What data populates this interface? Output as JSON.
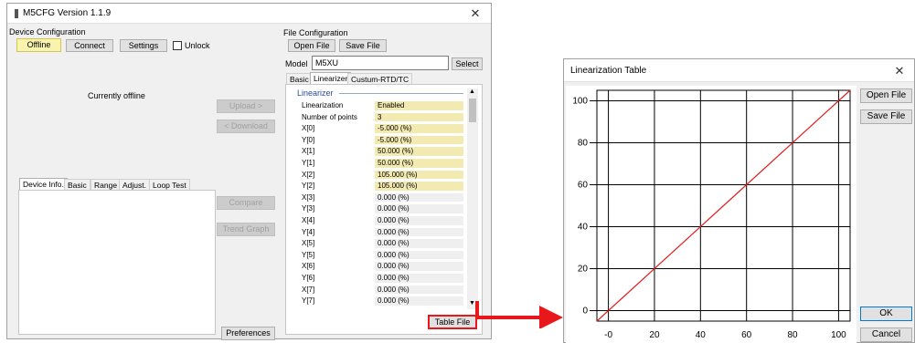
{
  "main_window": {
    "title": "M5CFG Version 1.1.9",
    "device_configuration": {
      "label": "Device Configuration",
      "offline_label": "Offline",
      "connect_label": "Connect",
      "settings_label": "Settings",
      "unlock_label": "Unlock",
      "unlock_checked": false,
      "status_text": "Currently offline",
      "tabs": [
        "Device Info.",
        "Basic",
        "Range",
        "Adjust.",
        "Loop Test"
      ]
    },
    "middle_buttons": {
      "upload_label": "Upload >",
      "download_label": "< Download",
      "compare_label": "Compare",
      "trend_graph_label": "Trend Graph",
      "preferences_label": "Preferences"
    },
    "file_configuration": {
      "label": "File Configuration",
      "open_file_label": "Open File",
      "save_file_label": "Save File",
      "model_label": "Model",
      "model_value": "M5XU",
      "select_label": "Select",
      "tabs": [
        "Basic",
        "Linearizer",
        "Custum-RTD/TC"
      ],
      "selected_tab": "Linearizer",
      "section_label": "Linearizer",
      "rows": [
        {
          "label": "Linearization",
          "value": "Enabled",
          "highlight": true
        },
        {
          "label": "Number of points",
          "value": "3",
          "highlight": true
        },
        {
          "label": "X[0]",
          "value": "-5.000 (%)",
          "highlight": true
        },
        {
          "label": "Y[0]",
          "value": "-5.000 (%)",
          "highlight": true
        },
        {
          "label": "X[1]",
          "value": "50.000 (%)",
          "highlight": true
        },
        {
          "label": "Y[1]",
          "value": "50.000 (%)",
          "highlight": true
        },
        {
          "label": "X[2]",
          "value": "105.000 (%)",
          "highlight": true
        },
        {
          "label": "Y[2]",
          "value": "105.000 (%)",
          "highlight": true
        },
        {
          "label": "X[3]",
          "value": "0.000 (%)",
          "highlight": false
        },
        {
          "label": "Y[3]",
          "value": "0.000 (%)",
          "highlight": false
        },
        {
          "label": "X[4]",
          "value": "0.000 (%)",
          "highlight": false
        },
        {
          "label": "Y[4]",
          "value": "0.000 (%)",
          "highlight": false
        },
        {
          "label": "X[5]",
          "value": "0.000 (%)",
          "highlight": false
        },
        {
          "label": "Y[5]",
          "value": "0.000 (%)",
          "highlight": false
        },
        {
          "label": "X[6]",
          "value": "0.000 (%)",
          "highlight": false
        },
        {
          "label": "Y[6]",
          "value": "0.000 (%)",
          "highlight": false
        },
        {
          "label": "X[7]",
          "value": "0.000 (%)",
          "highlight": false
        },
        {
          "label": "Y[7]",
          "value": "0.000 (%)",
          "highlight": false
        }
      ],
      "table_file_label": "Table File"
    }
  },
  "dialog": {
    "title": "Linearization Table",
    "open_file_label": "Open File",
    "save_file_label": "Save File",
    "ok_label": "OK",
    "cancel_label": "Cancel"
  },
  "colors": {
    "highlight_fill": "#f2eab0",
    "line_color": "#e02020",
    "arrow_color": "#e8171b"
  },
  "chart_data": {
    "type": "line",
    "x_ticks": [
      "-0",
      "20",
      "40",
      "60",
      "80",
      "100"
    ],
    "y_ticks": [
      "0",
      "20",
      "40",
      "60",
      "80",
      "100"
    ],
    "xlim": [
      -5,
      105
    ],
    "ylim": [
      -5,
      105
    ],
    "grid": true,
    "series": [
      {
        "x": [
          -5,
          50,
          105
        ],
        "values": [
          -5,
          50,
          105
        ]
      }
    ]
  },
  "icons": {
    "app_icon": "app-window-icon",
    "close": "close-icon",
    "arrow": "right-arrow-icon"
  }
}
